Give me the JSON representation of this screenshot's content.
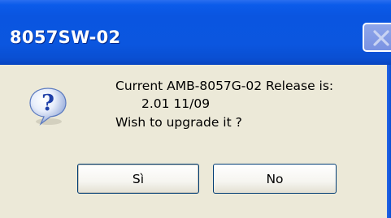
{
  "dialog": {
    "title": "8057SW-02",
    "close_icon": "close-icon",
    "icon": "question-icon",
    "message_line1": "Current AMB-8057G-02 Release is:",
    "message_line2": "2.01 11/09",
    "message_line3": "Wish to upgrade it ?",
    "buttons": {
      "yes_label": "Sì",
      "no_label": "No"
    }
  },
  "colors": {
    "titlebar": "#0a55e0",
    "dialog_background": "#ece9d8",
    "button_border": "#003c74"
  }
}
